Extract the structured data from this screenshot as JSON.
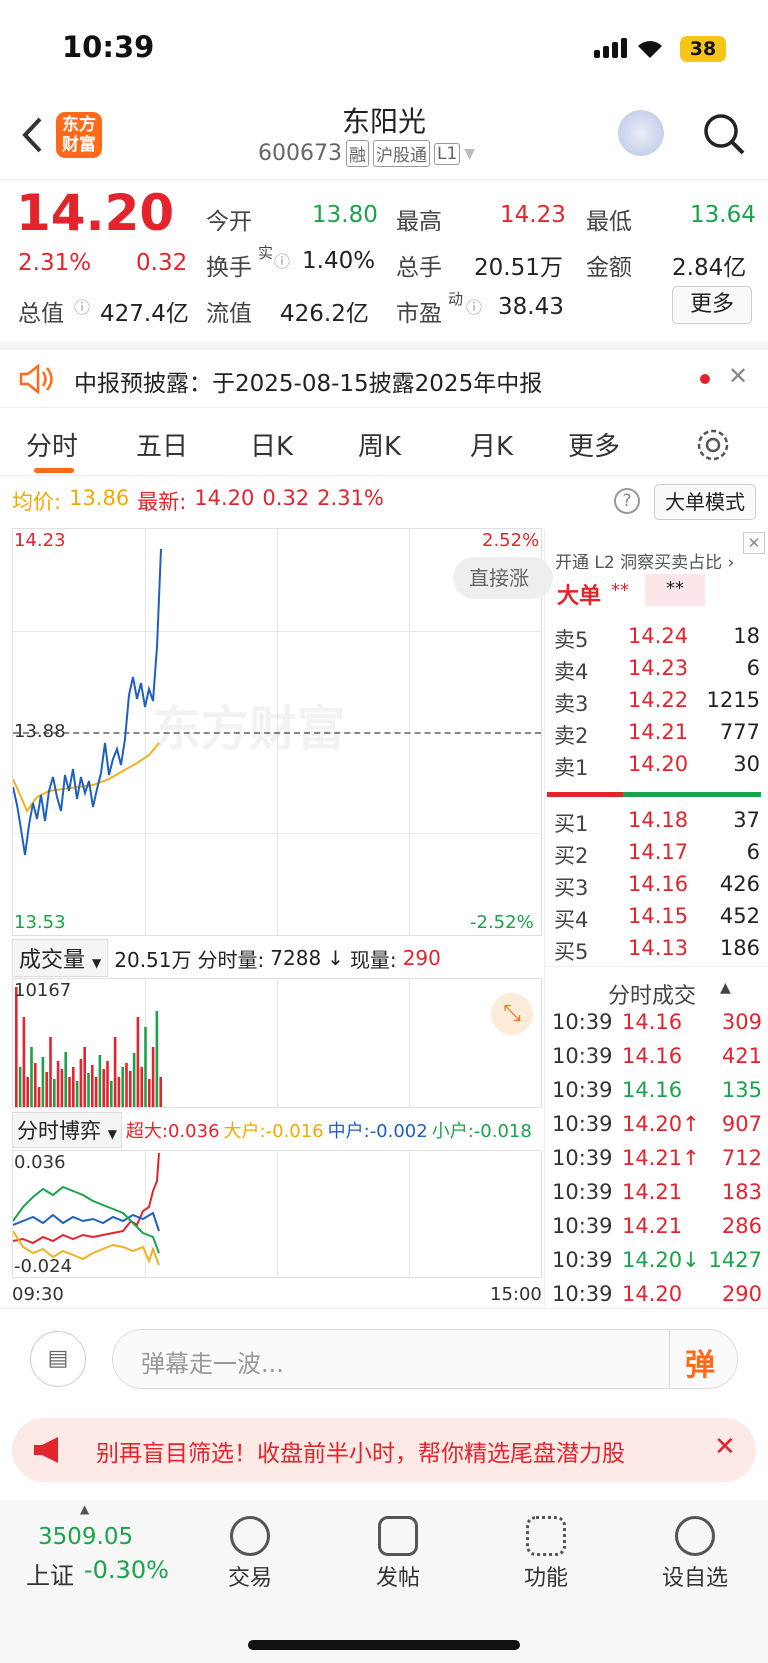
{
  "status": {
    "time": "10:39",
    "battery": "38"
  },
  "header": {
    "title": "东阳光",
    "code": "600673",
    "tags": [
      "融",
      "沪股通",
      "L1"
    ],
    "logo_text": "东方财富"
  },
  "quote": {
    "price": "14.20",
    "pct": "2.31%",
    "chg": "0.32",
    "open_label": "今开",
    "open": "13.80",
    "high_label": "最高",
    "high": "14.23",
    "low_label": "最低",
    "low": "13.64",
    "turnover_label": "换手",
    "turnover_sup": "实",
    "turnover": "1.40%",
    "vol_label": "总手",
    "vol": "20.51万",
    "amount_label": "金额",
    "amount": "2.84亿",
    "mcap_label": "总值",
    "mcap": "427.4亿",
    "float_label": "流值",
    "float": "426.2亿",
    "pe_label": "市盈",
    "pe_sup": "动",
    "pe": "38.43",
    "more": "更多"
  },
  "notice": {
    "text": "中报预披露：于2025-08-15披露2025年中报"
  },
  "tabs": [
    "分时",
    "五日",
    "日K",
    "周K",
    "月K",
    "更多"
  ],
  "chart_info": {
    "avg_label": "均价:",
    "avg": "13.86",
    "last_label": "最新:",
    "last": "14.20",
    "chg": "0.32",
    "pct": "2.31%",
    "mode": "大单模式"
  },
  "chart_axis": {
    "top": "14.23",
    "mid": "13.88",
    "bottom": "13.53",
    "top_pct": "2.52%",
    "bottom_pct": "-2.52%",
    "watermark": "东方财富",
    "overlay": "直接涨",
    "vol_max": "10167",
    "game_max": "0.036",
    "game_min": "-0.024",
    "t_start": "09:30",
    "t_end": "15:00"
  },
  "volume_bar": {
    "label": "成交量",
    "total": "20.51万",
    "minute_label": "分时量:",
    "minute": "7288",
    "now_label": "现量:",
    "now": "290"
  },
  "game_bar": {
    "label": "分时博弈",
    "s1": "超大:0.036",
    "s2": "大户:-0.016",
    "s3": "中户:-0.002",
    "s4": "小户:-0.018"
  },
  "orderbook": {
    "l2_text": "开通 L2 洞察买卖占比",
    "big_label": "大单",
    "big_val1": "**",
    "big_val2": "**",
    "sell": [
      {
        "l": "卖5",
        "p": "14.24",
        "v": "18"
      },
      {
        "l": "卖4",
        "p": "14.23",
        "v": "6"
      },
      {
        "l": "卖3",
        "p": "14.22",
        "v": "1215"
      },
      {
        "l": "卖2",
        "p": "14.21",
        "v": "777"
      },
      {
        "l": "卖1",
        "p": "14.20",
        "v": "30"
      }
    ],
    "buy": [
      {
        "l": "买1",
        "p": "14.18",
        "v": "37"
      },
      {
        "l": "买2",
        "p": "14.17",
        "v": "6"
      },
      {
        "l": "买3",
        "p": "14.16",
        "v": "426"
      },
      {
        "l": "买4",
        "p": "14.15",
        "v": "452"
      },
      {
        "l": "买5",
        "p": "14.13",
        "v": "186"
      }
    ]
  },
  "trades": {
    "title": "分时成交",
    "rows": [
      {
        "t": "10:39",
        "p": "14.16",
        "v": "309",
        "c": "r"
      },
      {
        "t": "10:39",
        "p": "14.16",
        "v": "421",
        "c": "r"
      },
      {
        "t": "10:39",
        "p": "14.16",
        "v": "135",
        "c": "g"
      },
      {
        "t": "10:39",
        "p": "14.20↑",
        "v": "907",
        "c": "r"
      },
      {
        "t": "10:39",
        "p": "14.21↑",
        "v": "712",
        "c": "r"
      },
      {
        "t": "10:39",
        "p": "14.21",
        "v": "183",
        "c": "r"
      },
      {
        "t": "10:39",
        "p": "14.21",
        "v": "286",
        "c": "r"
      },
      {
        "t": "10:39",
        "p": "14.20↓",
        "v": "1427",
        "c": "g"
      },
      {
        "t": "10:39",
        "p": "14.20",
        "v": "290",
        "c": "r"
      }
    ]
  },
  "comment": {
    "placeholder": "弹幕走一波...",
    "btn": "弹"
  },
  "banner": {
    "text": "别再盲目筛选！收盘前半小时，帮你精选尾盘潜力股"
  },
  "nav": {
    "index_val": "3509.05",
    "index_name": "上证",
    "index_pct": "-0.30%",
    "items": [
      "交易",
      "发帖",
      "功能",
      "设自选"
    ]
  }
}
